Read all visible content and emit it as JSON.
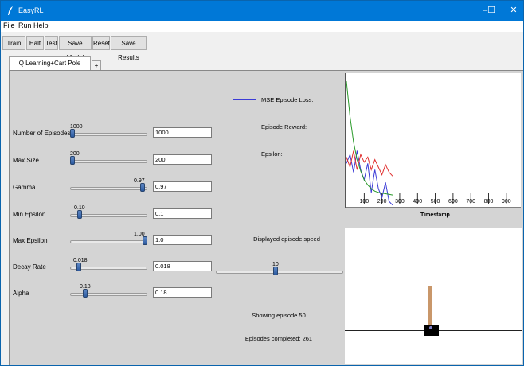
{
  "window": {
    "title": "EasyRL",
    "controls": [
      "–",
      "☐",
      "✕"
    ]
  },
  "menu": [
    "File",
    "Run",
    "Help"
  ],
  "toolbar": [
    "Train",
    "Halt",
    "Test",
    "Save Model",
    "Reset",
    "Save Results"
  ],
  "tabs": {
    "active": "Q Learning+Cart Pole Discrete",
    "add": "+"
  },
  "params": [
    {
      "label": "Number of Episodes",
      "slider_value": "1000",
      "field": "1000",
      "level": 0.0
    },
    {
      "label": "Max Size",
      "slider_value": "200",
      "field": "200",
      "level": 0.0
    },
    {
      "label": "Gamma",
      "slider_value": "0.97",
      "field": "0.97",
      "level": 0.97
    },
    {
      "label": "Min Epsilon",
      "slider_value": "0.10",
      "field": "0.1",
      "level": 0.1
    },
    {
      "label": "Max Epsilon",
      "slider_value": "1.00",
      "field": "1.0",
      "level": 1.0
    },
    {
      "label": "Decay Rate",
      "slider_value": "0.018",
      "field": "0.018",
      "level": 0.09
    },
    {
      "label": "Alpha",
      "slider_value": "0.18",
      "field": "0.18",
      "level": 0.18
    }
  ],
  "legend": [
    {
      "label": "MSE Episode Loss:",
      "color": "#3b3bd6"
    },
    {
      "label": "Episode Reward:",
      "color": "#e03030"
    },
    {
      "label": "Epsilon:",
      "color": "#2a9a2a"
    }
  ],
  "speed": {
    "label": "Displayed episode speed",
    "value": "10",
    "level": 0.47
  },
  "status": {
    "showing": "Showing episode 50",
    "completed": "Episodes completed: 261"
  },
  "chart_data": {
    "type": "line",
    "title": "",
    "xlabel": "Timestamp",
    "ylabel": "",
    "xlim": [
      0,
      950
    ],
    "x_ticks": [
      100,
      200,
      300,
      400,
      500,
      600,
      700,
      800,
      900
    ],
    "grid": false,
    "series": [
      {
        "name": "MSE Episode Loss:",
        "color": "#3b3bd6",
        "x": [
          0,
          20,
          40,
          60,
          80,
          100,
          120,
          140,
          160,
          180,
          200,
          220,
          240,
          260
        ],
        "y": [
          0.35,
          0.42,
          0.28,
          0.45,
          0.3,
          0.22,
          0.35,
          0.12,
          0.3,
          0.15,
          0.08,
          0.2,
          0.05,
          0.02
        ]
      },
      {
        "name": "Episode Reward:",
        "color": "#e03030",
        "x": [
          0,
          20,
          40,
          60,
          80,
          100,
          120,
          140,
          160,
          180,
          200,
          220,
          240,
          260
        ],
        "y": [
          0.4,
          0.32,
          0.45,
          0.3,
          0.42,
          0.36,
          0.4,
          0.3,
          0.38,
          0.32,
          0.26,
          0.34,
          0.28,
          0.25
        ]
      },
      {
        "name": "Epsilon:",
        "color": "#2a9a2a",
        "x": [
          0,
          20,
          40,
          60,
          80,
          100,
          120,
          140,
          160,
          180,
          200,
          220,
          240,
          260
        ],
        "y": [
          1.0,
          0.72,
          0.52,
          0.38,
          0.29,
          0.22,
          0.18,
          0.15,
          0.13,
          0.12,
          0.115,
          0.11,
          0.105,
          0.1
        ]
      }
    ]
  }
}
